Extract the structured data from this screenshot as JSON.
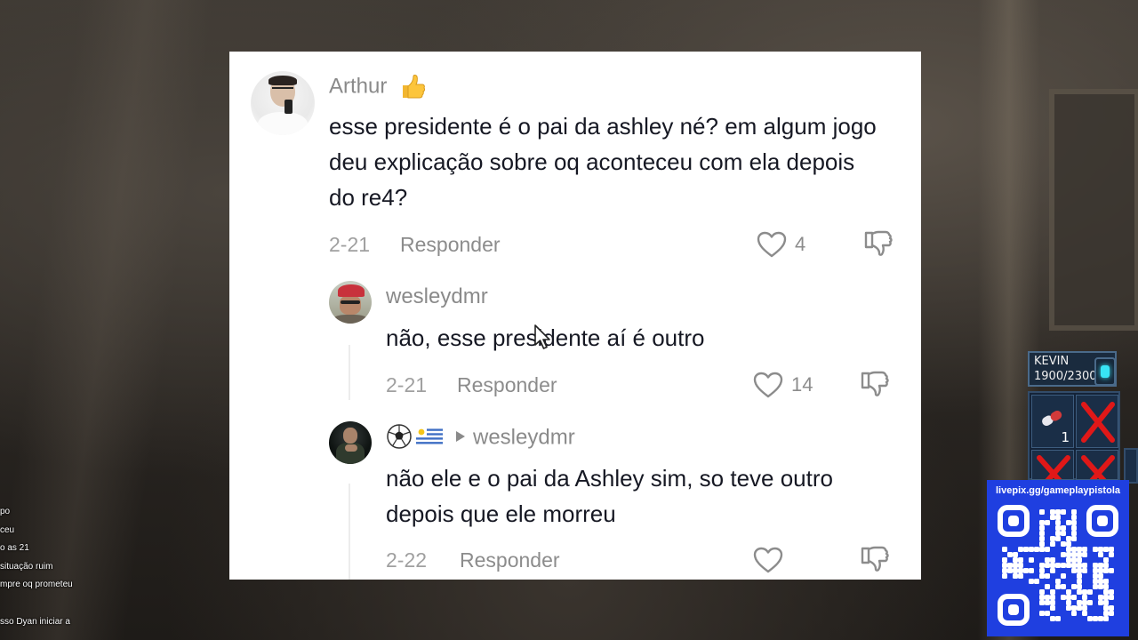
{
  "chat": {
    "lines": [
      "po",
      "ceu",
      "o as 21",
      "situação ruim",
      "mpre oq prometeu",
      "sso Dyan iniciar a"
    ]
  },
  "comments": [
    {
      "username": "Arthur",
      "text": "esse presidente é o pai da ashley né? em algum jogo deu explicação sobre oq aconteceu com ela depois do re4?",
      "date": "2-21",
      "reply_label": "Responder",
      "likes": "4"
    },
    {
      "username": "wesleydmr",
      "text": "não, esse presidente aí é outro",
      "date": "2-21",
      "reply_label": "Responder",
      "likes": "14"
    },
    {
      "reply_to": "wesleydmr",
      "text": "não ele e o pai da Ashley sim, so teve outro depois que ele morreu",
      "date": "2-22",
      "reply_label": "Responder",
      "likes": ""
    }
  ],
  "hud": {
    "name": "KEVIN",
    "hp": "1900/2300",
    "item_count": "1"
  },
  "qr": {
    "label": "livepix.gg/gameplaypistola"
  },
  "colors": {
    "card_bg": "#ffffff",
    "text_primary": "#161823",
    "text_secondary": "#8a8a8a",
    "qr_panel": "#1f3fe0",
    "hud_red_x": "#e01818"
  }
}
